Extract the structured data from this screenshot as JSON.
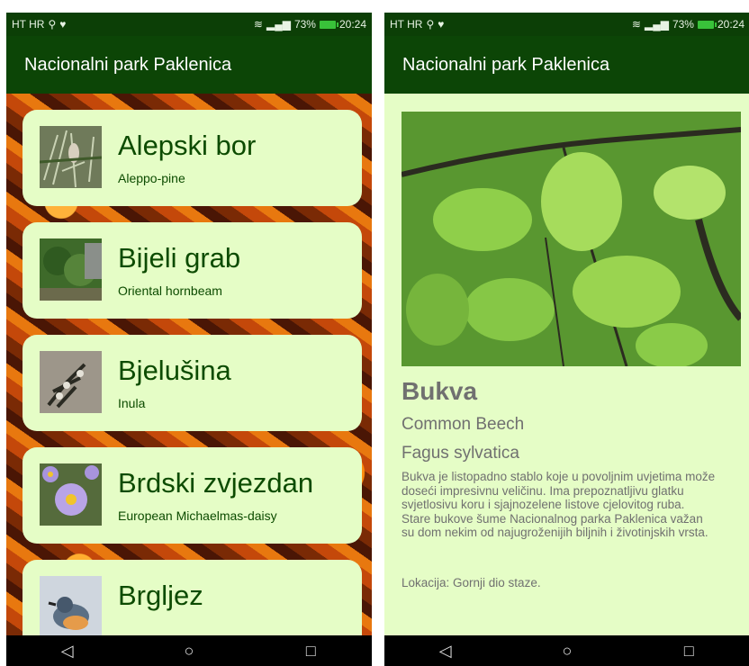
{
  "status_bar": {
    "carrier": "HT HR",
    "battery": "73%",
    "time": "20:24"
  },
  "app": {
    "title": "Nacionalni park Paklenica"
  },
  "list": [
    {
      "title": "Alepski bor",
      "subtitle": "Aleppo-pine",
      "thumb_icon": "aleppo-pine-photo"
    },
    {
      "title": "Bijeli grab",
      "subtitle": "Oriental hornbeam",
      "thumb_icon": "hornbeam-photo"
    },
    {
      "title": "Bjelušina",
      "subtitle": "Inula",
      "thumb_icon": "inula-photo"
    },
    {
      "title": "Brdski zvjezdan",
      "subtitle": "European Michaelmas-daisy",
      "thumb_icon": "daisy-photo"
    },
    {
      "title": "Brgljez",
      "subtitle": "",
      "thumb_icon": "bird-photo"
    }
  ],
  "detail": {
    "title": "Bukva",
    "common_name": "Common Beech",
    "latin_name": "Fagus sylvatica",
    "description": "Bukva je listopadno stablo koje u povoljnim uvjetima može doseći impresivnu veličinu. Ima prepoznatljivu glatku svjetlosivu koru i sjajnozelene listove cjelovitog ruba. Stare bukove šume Nacionalnog parka Paklenica važan su dom nekim od najugroženijih biljnih i životinjskih vrsta.",
    "location": "Lokacija: Gornji dio staze."
  },
  "nav": {
    "back": "◁",
    "home": "○",
    "recents": "□"
  },
  "colors": {
    "appbar": "#0c4506",
    "card": "#e5fdc6",
    "title_text": "#0c4b00",
    "detail_text": "#707070"
  }
}
